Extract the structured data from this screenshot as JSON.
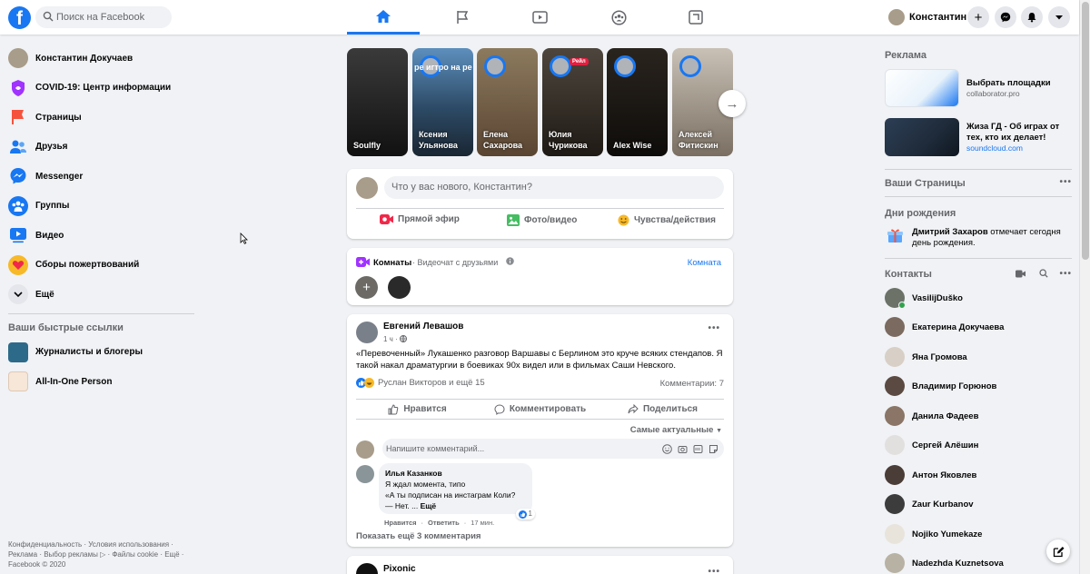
{
  "colors": {
    "brand": "#1877f2",
    "bg": "#f0f2f5",
    "card": "#ffffff",
    "text_secondary": "#65676b"
  },
  "topbar": {
    "logo_glyph": "f",
    "search_placeholder": "Поиск на Facebook",
    "nav_tabs": [
      {
        "name": "home",
        "icon": "home-icon",
        "active": true
      },
      {
        "name": "pages",
        "icon": "flag-icon",
        "active": false
      },
      {
        "name": "watch",
        "icon": "video-play-icon",
        "active": false
      },
      {
        "name": "groups",
        "icon": "groups-icon",
        "active": false
      },
      {
        "name": "gaming",
        "icon": "gaming-icon",
        "active": false
      }
    ],
    "user_name": "Константин",
    "buttons": [
      "plus-icon",
      "messenger-icon",
      "bell-icon",
      "caret-down-icon"
    ]
  },
  "left_nav": {
    "items": [
      {
        "label": "Константин Докучаев",
        "icon": "avatar-icon"
      },
      {
        "label": "COVID-19: Центр информации",
        "icon": "covid-shield-icon"
      },
      {
        "label": "Страницы",
        "icon": "pages-flag-icon"
      },
      {
        "label": "Друзья",
        "icon": "friends-icon"
      },
      {
        "label": "Messenger",
        "icon": "messenger-icon"
      },
      {
        "label": "Группы",
        "icon": "groups-icon"
      },
      {
        "label": "Видео",
        "icon": "video-icon"
      },
      {
        "label": "Сборы пожертвований",
        "icon": "fundraiser-heart-icon"
      },
      {
        "label": "Ещё",
        "icon": "chevron-down-icon"
      }
    ],
    "shortcuts_title": "Ваши быстрые ссылки",
    "shortcuts": [
      {
        "label": "Журналисты и блогеры"
      },
      {
        "label": "All-In-One Person"
      }
    ],
    "footer_lines": [
      "Конфиденциальность · Условия использования ·",
      "Реклама · Выбор рекламы ▷ · Файлы cookie · Ещё ·",
      "Facebook © 2020"
    ]
  },
  "stories": [
    {
      "name": "Soulfly",
      "bg": "#2a2a2a",
      "has_avatar": false,
      "badge": ""
    },
    {
      "name": "Ксения Ульянова",
      "bg": "#4a7fb0",
      "has_avatar": true,
      "badge": "",
      "overlay": "ре  игтро на ре"
    },
    {
      "name": "Елена Сахарова",
      "bg": "#7a6a52",
      "has_avatar": true,
      "badge": ""
    },
    {
      "name": "Юлия Чурикова",
      "bg": "#3d3630",
      "has_avatar": true,
      "badge": "Рейл"
    },
    {
      "name": "Alex Wise",
      "bg": "#1e1a16",
      "has_avatar": true,
      "badge": ""
    },
    {
      "name": "Алексей Фитискин",
      "bg": "#a39a8c",
      "has_avatar": true,
      "badge": ""
    }
  ],
  "composer": {
    "placeholder": "Что у вас нового, Константин?",
    "actions": [
      {
        "label": "Прямой эфир",
        "icon": "live-video-icon",
        "color": "#f02849"
      },
      {
        "label": "Фото/видео",
        "icon": "photo-icon",
        "color": "#45bd62"
      },
      {
        "label": "Чувства/действия",
        "icon": "feeling-icon",
        "color": "#f7b928"
      }
    ]
  },
  "rooms": {
    "title": "Комнаты",
    "subtitle": "· Видеочат с друзьями",
    "link": "Комната"
  },
  "post": {
    "author": "Евгений Левашов",
    "time": "1 ч ·",
    "text": "«Перевоченный» Лукашенко разговор Варшавы с Берлином это круче всяких стендапов. Я такой накал драматургии в боевиках 90х видел или в фильмах Саши Невского.",
    "reactions": "Руслан Викторов и ещё 15",
    "comments_count": "Комментарии: 7",
    "actions": [
      "Нравится",
      "Комментировать",
      "Поделиться"
    ],
    "sort_label": "Самые актуальные",
    "comment_placeholder": "Напишите комментарий...",
    "comment": {
      "author": "Илья Казанков",
      "text_lines": [
        "Я ждал момента, типо",
        "«А ты подписан на инстаграм Коли?",
        "— Нет. ..."
      ],
      "more": "Ещё",
      "like": "Нравится",
      "reply": "Ответить",
      "time": "17 мин.",
      "likes": "1"
    },
    "more_comments": "Показать ещё 3 комментария"
  },
  "post2": {
    "author": "Pixonic"
  },
  "right": {
    "ads_title": "Реклама",
    "ads": [
      {
        "title": "Выбрать площадки",
        "sub": "collaborator.pro",
        "bg": "#e8f2fb"
      },
      {
        "title": "Жиза ГД - Об играх от тех, кто их делает!",
        "sub": "soundcloud.com",
        "bg": "#1f2b3a"
      }
    ],
    "pages_title": "Ваши Страницы",
    "birthdays_title": "Дни рождения",
    "birthday_name": "Дмитрий Захаров",
    "birthday_text": " отмечает сегодня день рождения.",
    "contacts_title": "Контакты",
    "contacts": [
      {
        "name": "VasilijDuško",
        "online": true
      },
      {
        "name": "Екатерина Докучаева",
        "online": false
      },
      {
        "name": "Яна Громова",
        "online": false
      },
      {
        "name": "Владимир Горюнов",
        "online": false
      },
      {
        "name": "Данила Фадеев",
        "online": false
      },
      {
        "name": "Сергей Алёшин",
        "online": false
      },
      {
        "name": "Антон Яковлев",
        "online": false
      },
      {
        "name": "Zaur Kurbanov",
        "online": false
      },
      {
        "name": "Nojiko Yumekaze",
        "online": false
      },
      {
        "name": "Nadezhda Kuznetsova",
        "online": false
      }
    ]
  }
}
